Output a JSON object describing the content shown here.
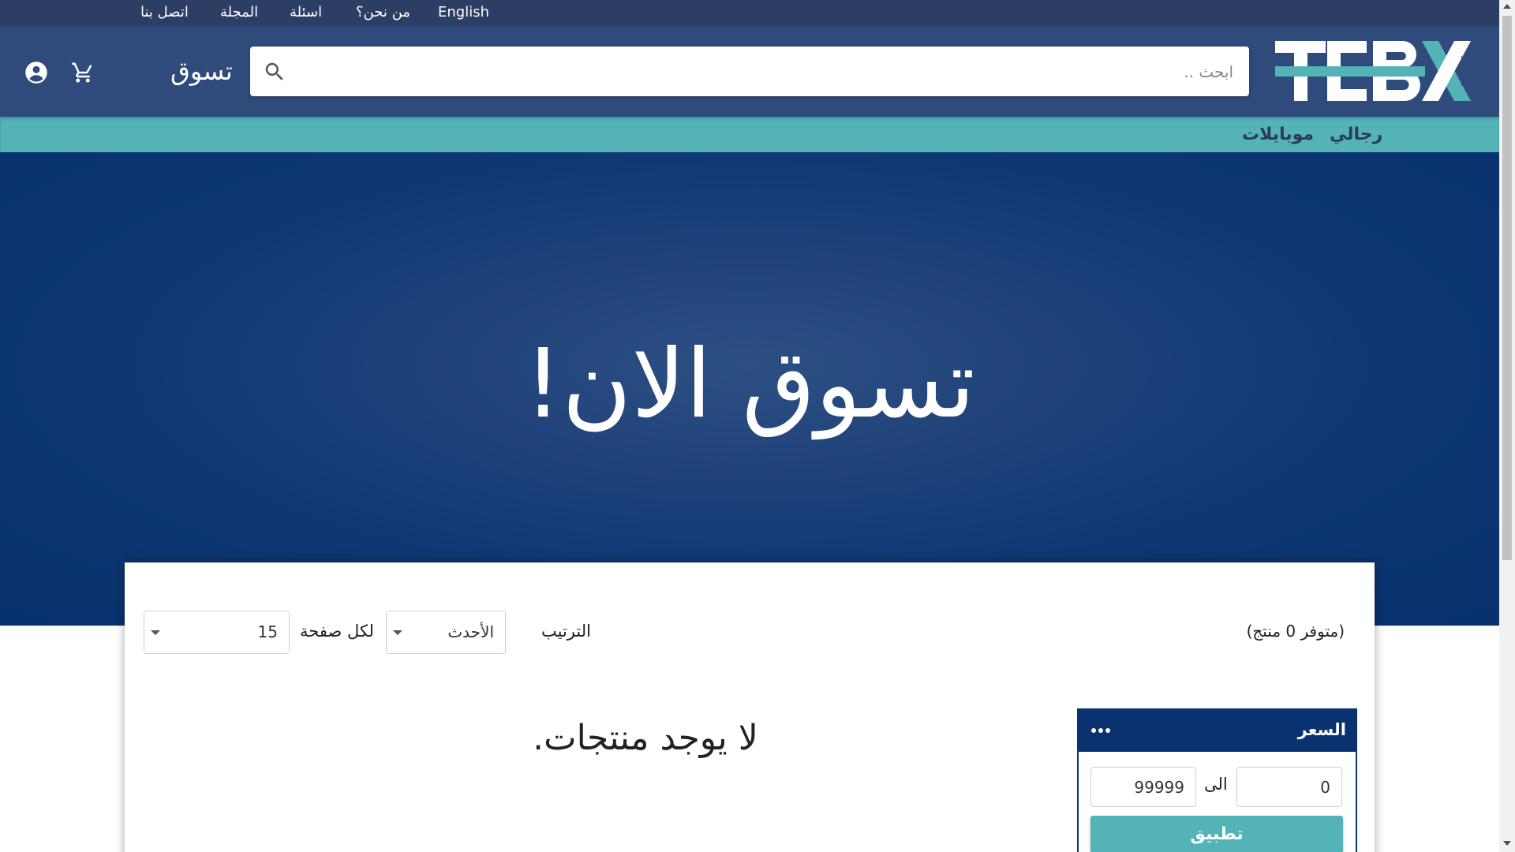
{
  "topbar": {
    "links": [
      "English",
      "من نحن؟",
      "اسئلة",
      "المجلة",
      "اتصل بنا"
    ]
  },
  "header": {
    "shop_label": "تسوق",
    "search_placeholder": "ابحث ..",
    "logo_text": "TEBX",
    "icons": [
      "account-circle-icon",
      "shopping-cart-icon",
      "search-icon"
    ]
  },
  "categories": [
    "رجالي",
    "موبايلات"
  ],
  "hero": {
    "title": "تسوق الان!"
  },
  "results": {
    "count_label": "(متوفر 0 منتج)",
    "sort_label": "الترتيب",
    "sort_value": "الأحدث",
    "per_page_label": "لكل صفحة",
    "per_page_value": "15",
    "empty_message": "لا يوجد منتجات."
  },
  "price_filter": {
    "title": "السعر",
    "min_value": "0",
    "max_value": "99999",
    "to_label": "الى",
    "apply_label": "تطبيق"
  },
  "colors": {
    "topbar": "#2c3e64",
    "header": "#2f4b7c",
    "accent_teal": "#53b3b7",
    "hero_navy": "#0e3773",
    "panel_navy": "#0b3270"
  }
}
